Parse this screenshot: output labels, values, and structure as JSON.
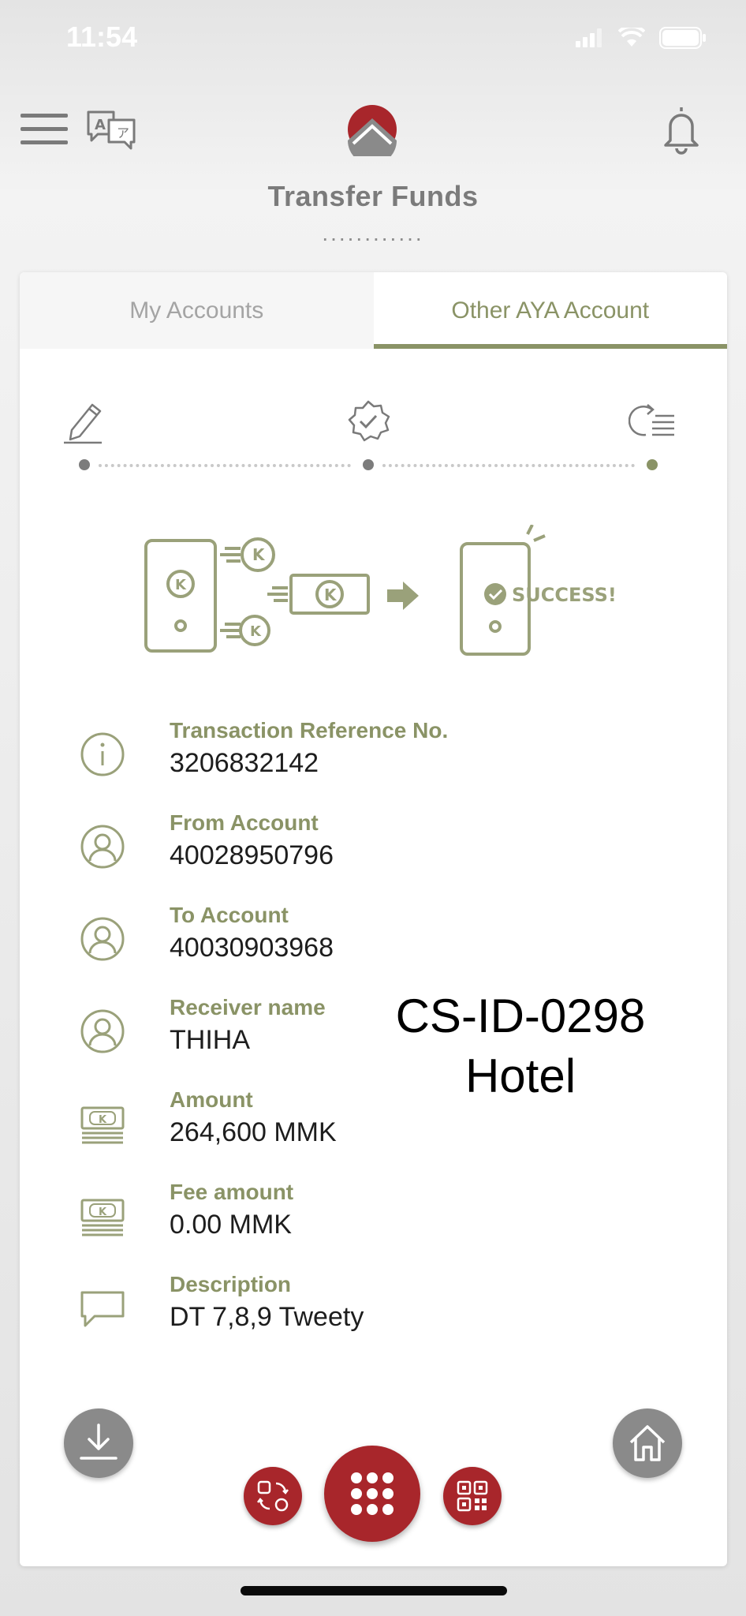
{
  "status": {
    "time": "11:54"
  },
  "header": {
    "title": "Transfer Funds",
    "dots": "............"
  },
  "tabs": [
    {
      "label": "My Accounts",
      "active": false
    },
    {
      "label": "Other AYA Account",
      "active": true
    }
  ],
  "illustration": {
    "success_text": "SUCCESS!",
    "currency_glyph": "K"
  },
  "details": [
    {
      "label": "Transaction Reference No.",
      "value": "3206832142",
      "icon": "info-icon"
    },
    {
      "label": "From Account",
      "value": "40028950796",
      "icon": "user-icon"
    },
    {
      "label": "To Account",
      "value": "40030903968",
      "icon": "user-icon"
    },
    {
      "label": "Receiver name",
      "value": "THIHA",
      "icon": "user-icon"
    },
    {
      "label": "Amount",
      "value": "264,600 MMK",
      "icon": "money-icon"
    },
    {
      "label": "Fee amount",
      "value": "0.00 MMK",
      "icon": "money-icon"
    },
    {
      "label": "Description",
      "value": "DT 7,8,9 Tweety",
      "icon": "chat-icon"
    }
  ],
  "overlay": {
    "line1": "CS-ID-0298",
    "line2": "Hotel"
  },
  "colors": {
    "accent": "#8a9366",
    "brand_red": "#a8262b",
    "fab_gray": "#8a8a8a"
  }
}
